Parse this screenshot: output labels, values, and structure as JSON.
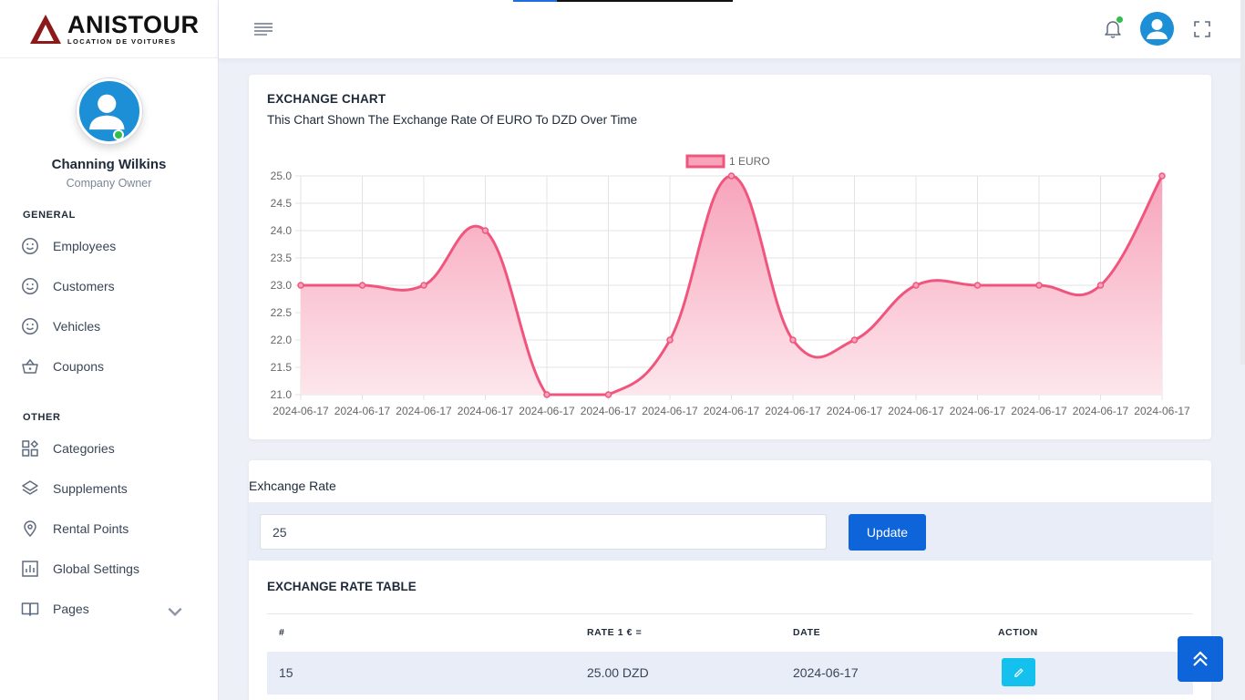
{
  "brand": {
    "name": "ANISTOUR",
    "tagline": "LOCATION DE VOITURES"
  },
  "profile": {
    "name": "Channing Wilkins",
    "role": "Company Owner",
    "status": "online"
  },
  "sidebar": {
    "sections": [
      {
        "title": "GENERAL",
        "items": [
          {
            "label": "Employees",
            "icon": "smiley-icon"
          },
          {
            "label": "Customers",
            "icon": "smiley-icon"
          },
          {
            "label": "Vehicles",
            "icon": "smiley-icon"
          },
          {
            "label": "Coupons",
            "icon": "basket-icon"
          }
        ]
      },
      {
        "title": "OTHER",
        "items": [
          {
            "label": "Categories",
            "icon": "grid-icon"
          },
          {
            "label": "Supplements",
            "icon": "layers-icon"
          },
          {
            "label": "Rental Points",
            "icon": "map-pin-icon"
          },
          {
            "label": "Global Settings",
            "icon": "bar-chart-icon"
          },
          {
            "label": "Pages",
            "icon": "book-icon",
            "has_submenu": true
          }
        ]
      }
    ]
  },
  "topbar": {
    "notification_badge": true
  },
  "chart_card": {
    "title": "EXCHANGE CHART",
    "subtitle": "This Chart Shown The Exchange Rate Of EURO To DZD Over Time"
  },
  "chart_data": {
    "type": "line",
    "x": [
      "2024-06-17",
      "2024-06-17",
      "2024-06-17",
      "2024-06-17",
      "2024-06-17",
      "2024-06-17",
      "2024-06-17",
      "2024-06-17",
      "2024-06-17",
      "2024-06-17",
      "2024-06-17",
      "2024-06-17",
      "2024-06-17",
      "2024-06-17",
      "2024-06-17"
    ],
    "series": [
      {
        "name": "1 EURO",
        "values": [
          23,
          23,
          23,
          24,
          21,
          21,
          22,
          25,
          22,
          22,
          23,
          23,
          23,
          23,
          25
        ]
      }
    ],
    "ylim": [
      21.0,
      25.0
    ],
    "yticks": [
      "21.0",
      "21.5",
      "22.0",
      "22.5",
      "23.0",
      "23.5",
      "24.0",
      "24.5",
      "25.0"
    ],
    "legend": "top-center",
    "grid": true,
    "fill": true,
    "color": "#f0567d",
    "fill_color_top": "#f7a4bb",
    "fill_color_bottom": "#fde6ec"
  },
  "exchange": {
    "label": "Exhcange Rate",
    "input_value": "25",
    "update_label": "Update"
  },
  "table": {
    "title": "EXCHANGE RATE TABLE",
    "headers": [
      "#",
      "RATE 1 € =",
      "DATE",
      "ACTION"
    ],
    "rows": [
      {
        "id": "15",
        "rate": "25.00 DZD",
        "date": "2024-06-17"
      }
    ]
  },
  "colors": {
    "primary": "#0d65d9",
    "edit": "#14c0ee",
    "online": "#2fbf4a",
    "band": "#e9edf8"
  }
}
